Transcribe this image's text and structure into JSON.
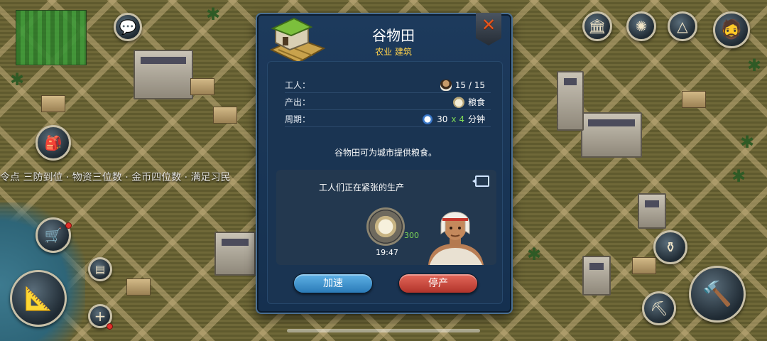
{
  "ticker": {
    "text": "令点 三防到位 · 物资三位数 · 金币四位数 · 满足习民"
  },
  "dialog": {
    "title": "谷物田",
    "subtitle": "农业 建筑",
    "close_icon": "close-x-icon",
    "stats": {
      "workers": {
        "label": "工人：",
        "value": "15 / 15",
        "icon": "worker-icon"
      },
      "output": {
        "label": "产出：",
        "value": "粮食",
        "icon": "grain-icon"
      },
      "cycle": {
        "label": "周期：",
        "amount": "30",
        "multiplier": "x 4",
        "unit": "分钟",
        "icon": "clock-icon"
      }
    },
    "description": "谷物田可为城市提供粮食。",
    "production": {
      "status": "工人们正在紧张的生产",
      "output_amount": "300",
      "timer": "19:47"
    },
    "buttons": {
      "speed_up": "加速",
      "stop": "停产"
    }
  },
  "hud": {
    "left_buttons": [
      "chat-icon",
      "backpack-icon",
      "market-cart-icon",
      "terrain-layer-icon",
      "add-icon",
      "blueprint-compass-icon"
    ],
    "top_right_buttons": [
      "temple-event-icon",
      "compass-icon",
      "pyramid-icon",
      "advisor-avatar"
    ],
    "bottom_right_buttons": [
      "vase-icon",
      "shovel-icon",
      "hammer-icon"
    ]
  },
  "colors": {
    "dialog_bg": "#1d3a5c",
    "subtitle": "#ffd24a",
    "multiplier": "#7ed857",
    "speed_button": "#3f95d0",
    "stop_button": "#cc4a3d"
  }
}
